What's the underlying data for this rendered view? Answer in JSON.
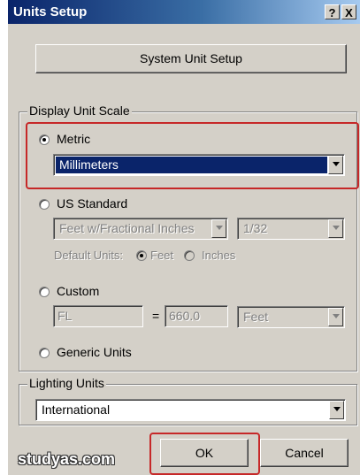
{
  "window": {
    "title": "Units Setup",
    "help_glyph": "?",
    "close_glyph": "X"
  },
  "system_unit_setup_button": "System Unit Setup",
  "display_unit_scale": {
    "legend": "Display Unit Scale",
    "metric": {
      "label": "Metric",
      "selected": true,
      "dropdown_value": "Millimeters"
    },
    "us_standard": {
      "label": "US Standard",
      "dropdown_value": "Feet w/Fractional Inches",
      "fraction_value": "1/32",
      "default_units_label": "Default Units:",
      "feet_label": "Feet",
      "inches_label": "Inches"
    },
    "custom": {
      "label": "Custom",
      "name_value": "FL",
      "equals": "=",
      "amount_value": "660.0",
      "unit_value": "Feet"
    },
    "generic": {
      "label": "Generic Units"
    }
  },
  "lighting_units": {
    "legend": "Lighting Units",
    "dropdown_value": "International"
  },
  "buttons": {
    "ok": "OK",
    "cancel": "Cancel"
  },
  "watermark": "studyas.com",
  "colors": {
    "highlight": "#c62828",
    "selection": "#0a246a",
    "dialog": "#d4d0c8"
  }
}
